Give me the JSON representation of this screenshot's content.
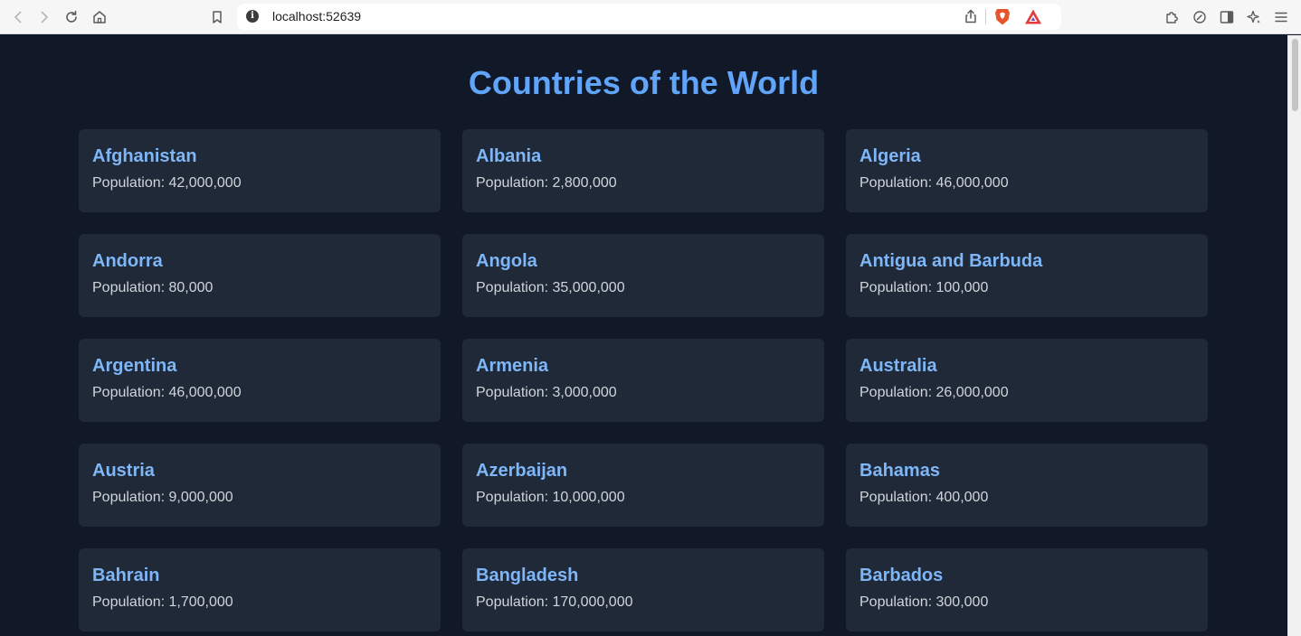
{
  "browser": {
    "url": "localhost:52639"
  },
  "page": {
    "title": "Countries of the World",
    "countries": [
      {
        "name": "Afghanistan",
        "population": "Population: 42,000,000"
      },
      {
        "name": "Albania",
        "population": "Population: 2,800,000"
      },
      {
        "name": "Algeria",
        "population": "Population: 46,000,000"
      },
      {
        "name": "Andorra",
        "population": "Population: 80,000"
      },
      {
        "name": "Angola",
        "population": "Population: 35,000,000"
      },
      {
        "name": "Antigua and Barbuda",
        "population": "Population: 100,000"
      },
      {
        "name": "Argentina",
        "population": "Population: 46,000,000"
      },
      {
        "name": "Armenia",
        "population": "Population: 3,000,000"
      },
      {
        "name": "Australia",
        "population": "Population: 26,000,000"
      },
      {
        "name": "Austria",
        "population": "Population: 9,000,000"
      },
      {
        "name": "Azerbaijan",
        "population": "Population: 10,000,000"
      },
      {
        "name": "Bahamas",
        "population": "Population: 400,000"
      },
      {
        "name": "Bahrain",
        "population": "Population: 1,700,000"
      },
      {
        "name": "Bangladesh",
        "population": "Population: 170,000,000"
      },
      {
        "name": "Barbados",
        "population": "Population: 300,000"
      }
    ]
  },
  "colors": {
    "background": "#111827",
    "card": "#1f2937",
    "title": "#60a5fa",
    "country_name": "#7eb6f8",
    "population_text": "#d1d5db"
  }
}
